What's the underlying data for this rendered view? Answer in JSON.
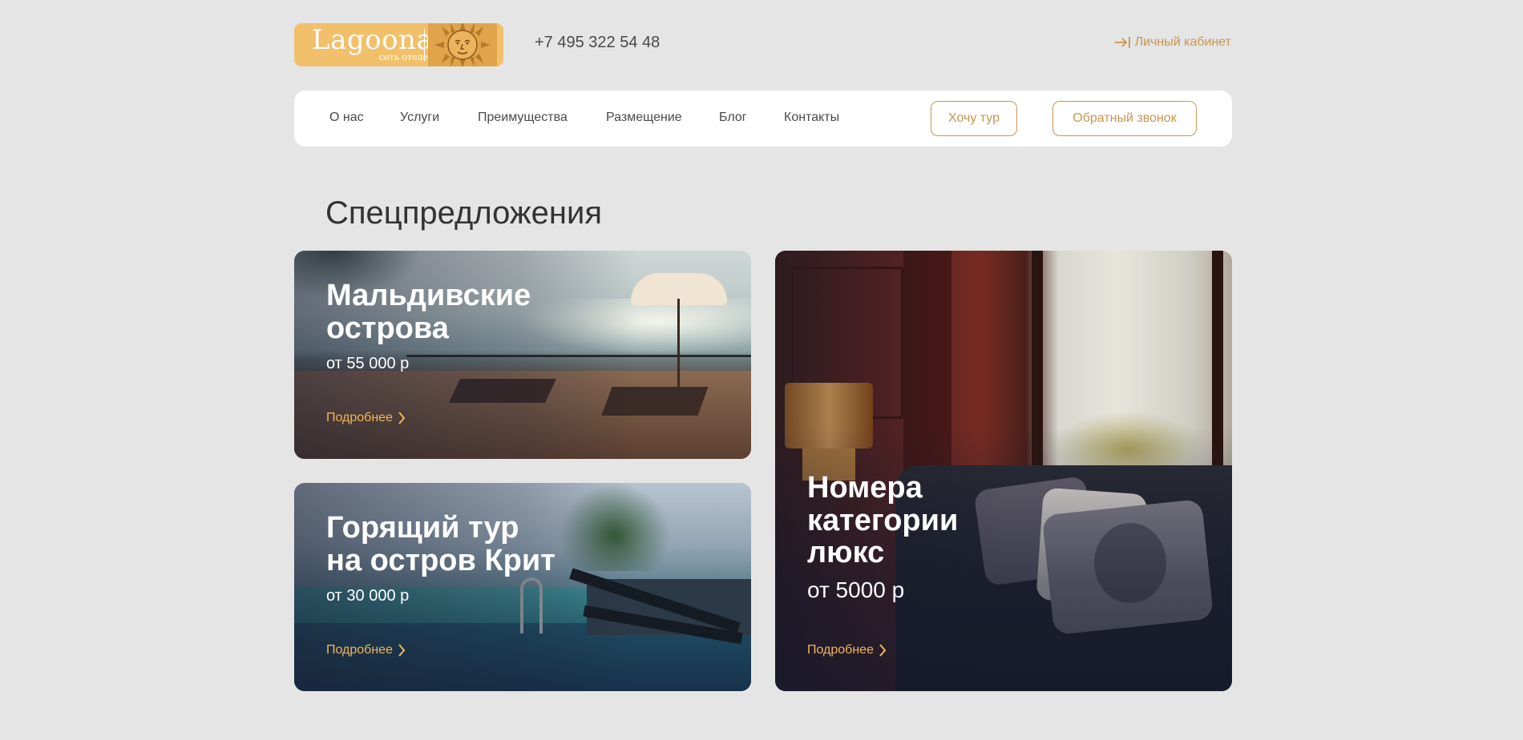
{
  "header": {
    "logo_title": "Lagoona",
    "logo_subtitle": "сеть отелей",
    "phone": "+7 495 322 54 48",
    "cabinet_label": "Личный кабинет"
  },
  "nav": {
    "items": [
      {
        "label": "О нас"
      },
      {
        "label": "Услуги"
      },
      {
        "label": "Преимущества"
      },
      {
        "label": "Размещение"
      },
      {
        "label": "Блог"
      },
      {
        "label": "Контакты"
      }
    ],
    "tour_button": "Хочу тур",
    "callback_button": "Обратный звонок"
  },
  "section": {
    "title": "Спецпредложения"
  },
  "cards": [
    {
      "title_line1": "Мальдивские",
      "title_line2": "острова",
      "price": "от 55 000 р",
      "more": "Подробнее"
    },
    {
      "title_line1": "Горящий тур",
      "title_line2": "на остров Крит",
      "price": "от 30 000 р",
      "more": "Подробнее"
    },
    {
      "title_line1": "Номера",
      "title_line2": "категории",
      "title_line3": "люкс",
      "price": "от 5000 р",
      "more": "Подробнее"
    }
  ],
  "colors": {
    "accent": "#c9954e",
    "link": "#f3b65a",
    "logo_bg": "#f2c06b",
    "page_bg": "#e5e5e5"
  },
  "icons": {
    "cabinet": "login-arrow-icon",
    "more": "chevron-right-icon",
    "logo": "sun-face-icon"
  }
}
